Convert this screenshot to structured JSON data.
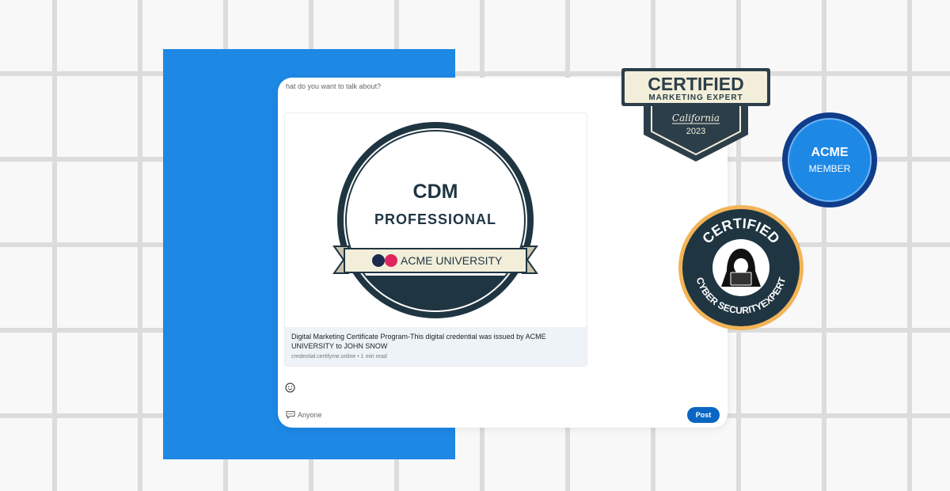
{
  "composer": {
    "prompt": "hat do you want to talk about?",
    "audience": "Anyone",
    "post_label": "Post"
  },
  "shared_badge": {
    "title": "CDM",
    "subtitle": "PROFESSIONAL",
    "ribbon": "ACME UNIVERSITY"
  },
  "link_preview": {
    "title": "Digital Marketing Certificate Program-This digital credential was issued by ACME UNIVERSITY to JOHN SNOW",
    "meta": "credential.certifyme.online • 1 min read"
  },
  "badges": {
    "marketing": {
      "title": "CERTIFIED",
      "subtitle": "MARKETING EXPERT",
      "location": "California",
      "year": "2023"
    },
    "acme": {
      "title": "ACME",
      "subtitle": "MEMBER"
    },
    "cyber": {
      "top": "CERTIFIED",
      "bottom": "CYBER SECURITYEXPERT"
    }
  },
  "colors": {
    "accent_blue": "#1e88e5",
    "post_button": "#0a66c2",
    "badge_navy": "#1f3542",
    "badge_gold": "#f2b457",
    "ribbon_cream": "#f2eed9",
    "dot_navy": "#1b2b4d",
    "dot_pink": "#e0245e"
  },
  "icons": {
    "emoji": "smiley-icon",
    "audience": "speech-bubble-icon",
    "cyber": "hooded-hacker-icon"
  }
}
